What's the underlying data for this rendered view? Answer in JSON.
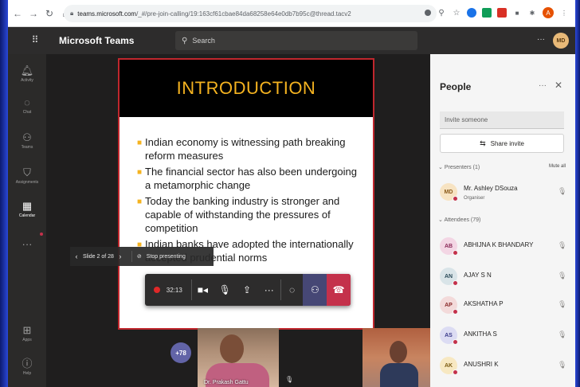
{
  "browser": {
    "url_host": "teams.microsoft.com",
    "url_path": "/_#/pre-join-calling/19:163cf61cbae84da68258e64e0db7b95c@thread.tacv2"
  },
  "header": {
    "app_title": "Microsoft Teams",
    "search_placeholder": "Search",
    "more": "···",
    "user_initials": "MD"
  },
  "rail": {
    "items": [
      {
        "label": "Activity",
        "icon": "bell-icon"
      },
      {
        "label": "Chat",
        "icon": "chat-icon"
      },
      {
        "label": "Teams",
        "icon": "teams-icon"
      },
      {
        "label": "Assignments",
        "icon": "assignments-icon"
      },
      {
        "label": "Calendar",
        "icon": "calendar-icon"
      },
      {
        "label": "Apps",
        "icon": "apps-icon"
      },
      {
        "label": "Help",
        "icon": "help-icon"
      }
    ]
  },
  "slide": {
    "title": "INTRODUCTION",
    "bullets": [
      "Indian economy is witnessing path breaking reform measures",
      "The financial sector has also been undergoing a metamorphic change",
      "Today the banking industry is stronger and capable of withstanding the pressures of competition",
      "Indian banks have adopted the internationally accepted prudential norms"
    ],
    "nav_label": "Slide 2 of 28",
    "stop_label": "Stop presenting"
  },
  "call": {
    "timer": "32:13",
    "more_participants": "+78",
    "tile1_name": "Dr. Prakash Gattu"
  },
  "people": {
    "title": "People",
    "invite_placeholder": "Invite someone",
    "share_label": "Share invite",
    "presenters_header": "Presenters (1)",
    "mute_all": "Mute all",
    "attendees_header": "Attendees (79)",
    "presenters": [
      {
        "initials": "MD",
        "name": "Mr. Ashley DSouza",
        "role": "Organiser",
        "bg": "#f7e3c2",
        "fg": "#8a5a1a"
      }
    ],
    "attendees": [
      {
        "initials": "AB",
        "name": "ABHIJNA K BHANDARY",
        "bg": "#f3d6e4",
        "fg": "#8a2a58"
      },
      {
        "initials": "AN",
        "name": "AJAY S N",
        "bg": "#d9e4e8",
        "fg": "#2a4a58"
      },
      {
        "initials": "AP",
        "name": "AKSHATHA P",
        "bg": "#f3dada",
        "fg": "#8a2a2a"
      },
      {
        "initials": "AS",
        "name": "ANKITHA S",
        "bg": "#dcdcf3",
        "fg": "#3a3a8a"
      },
      {
        "initials": "AK",
        "name": "ANUSHRI K",
        "bg": "#f7e8c2",
        "fg": "#7a5a10"
      }
    ]
  }
}
